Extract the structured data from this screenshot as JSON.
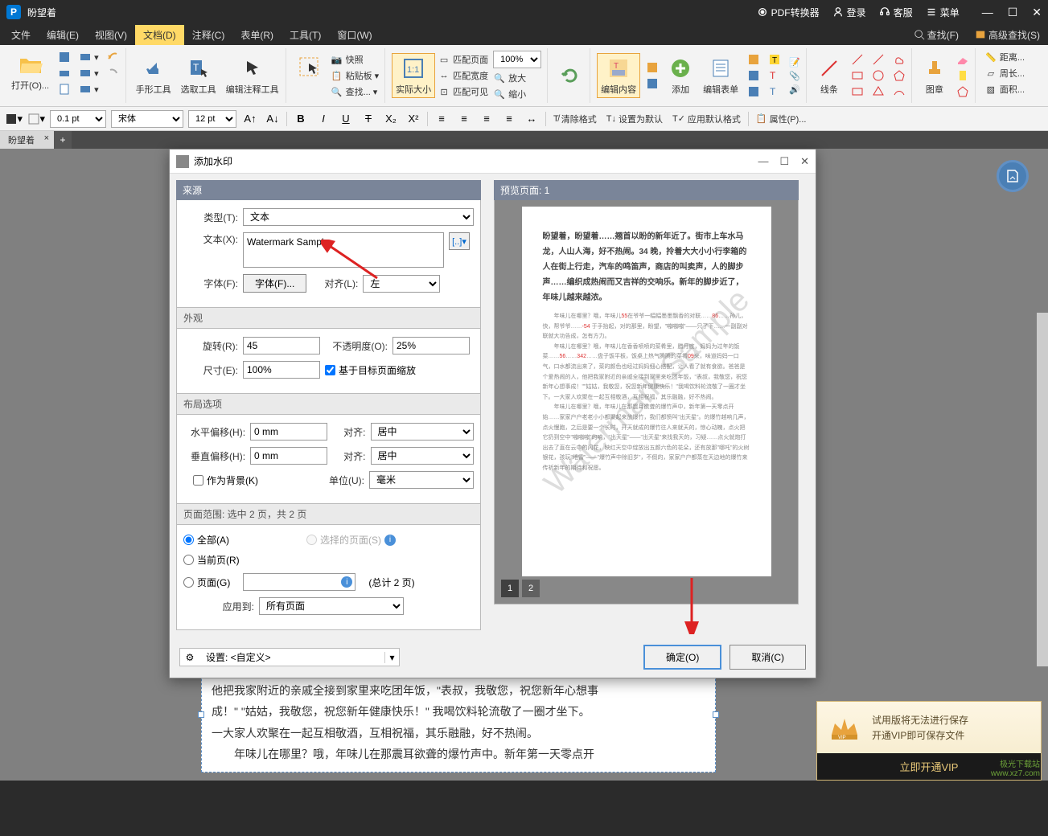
{
  "titlebar": {
    "app_title": "盼望着",
    "pdf_label": "PDF转换器",
    "login_label": "登录",
    "support_label": "客服",
    "menu_label": "菜单"
  },
  "menubar": {
    "items": [
      {
        "label": "文件"
      },
      {
        "label": "编辑(E)"
      },
      {
        "label": "视图(V)"
      },
      {
        "label": "文档(D)"
      },
      {
        "label": "注释(C)"
      },
      {
        "label": "表单(R)"
      },
      {
        "label": "工具(T)"
      },
      {
        "label": "窗口(W)"
      }
    ],
    "find_label": "查找(F)",
    "adv_find_label": "高级查找(S)"
  },
  "ribbon": {
    "open_label": "打开(O)...",
    "quick_label": "快照",
    "paste_label": "粘贴板",
    "find_label": "查找...",
    "hand_tool": "手形工具",
    "select_tool": "选取工具",
    "annot_tool": "编辑注释工具",
    "actual_size": "实际大小",
    "fit_page": "匹配页面",
    "fit_width": "匹配宽度",
    "fit_visible": "匹配可见",
    "zoom_100": "100%",
    "zoom_in": "放大",
    "zoom_out": "缩小",
    "edit_content": "编辑内容",
    "add_label": "添加",
    "edit_form": "编辑表单",
    "line_label": "线条",
    "stamp_label": "图章",
    "distance_label": "距离...",
    "perimeter_label": "周长...",
    "area_label": "面积..."
  },
  "format": {
    "line_width": "0.1 pt",
    "font_name": "宋体",
    "font_size": "12 pt",
    "clear_fmt": "清除格式",
    "set_default": "设置为默认",
    "apply_default": "应用默认格式",
    "properties": "属性(P)..."
  },
  "tabs": {
    "tab1": "盼望着"
  },
  "dialog": {
    "title": "添加水印",
    "source_header": "来源",
    "type_label": "类型(T):",
    "type_value": "文本",
    "text_label": "文本(X):",
    "text_value": "Watermark Sample",
    "font_label": "字体(F):",
    "font_btn": "字体(F)...",
    "align_label": "对齐(L):",
    "align_value": "左",
    "appearance_header": "外观",
    "rotate_label": "旋转(R):",
    "rotate_value": "45",
    "opacity_label": "不透明度(O):",
    "opacity_value": "25%",
    "size_label": "尺寸(E):",
    "size_value": "100%",
    "scale_target": "基于目标页面缩放",
    "layout_header": "布局选项",
    "hoffset_label": "水平偏移(H):",
    "hoffset_value": "0 mm",
    "halign_label": "对齐:",
    "halign_value": "居中",
    "voffset_label": "垂直偏移(H):",
    "voffset_value": "0 mm",
    "valign_label": "对齐:",
    "valign_value": "居中",
    "as_bg": "作为背景(K)",
    "unit_label": "单位(U):",
    "unit_value": "毫米",
    "range_header": "页面范围: 选中 2 页，共 2 页",
    "range_all": "全部(A)",
    "range_selected": "选择的页面(S)",
    "range_current": "当前页(R)",
    "range_pages": "页面(G)",
    "range_total": "(总计 2 页)",
    "apply_label": "应用到:",
    "apply_value": "所有页面",
    "preview_header": "预览页面: 1",
    "preview_watermark": "Watermark Sample",
    "settings_label": "设置: <自定义>",
    "ok_btn": "确定(O)",
    "cancel_btn": "取消(C)",
    "thumb1": "1",
    "thumb2": "2"
  },
  "doc": {
    "line1": "来了。菜的颜色也经过妈妈细心搭配，让人看了就有食欲。爸爸是个爱热闹的人，",
    "line2": "他把我家附近的亲戚全接到家里来吃团年饭，\"表叔，我敬您，祝您新年心想事",
    "line3": "成！\" \"姑姑，我敬您，祝您新年健康快乐！\" 我喝饮料轮流敬了一圈才坐下。",
    "line4": "一大家人欢聚在一起互相敬酒，互相祝福，其乐融融，好不热闹。",
    "line5": "　　年味儿在哪里？哦，年味儿在那震耳欲聋的爆竹声中。新年第一天零点开"
  },
  "vip": {
    "line1": "试用版将无法进行保存",
    "line2": "开通VIP即可保存文件",
    "btn": "立即开通VIP"
  },
  "site_watermark": "极光下载站\nwww.xz7.com"
}
